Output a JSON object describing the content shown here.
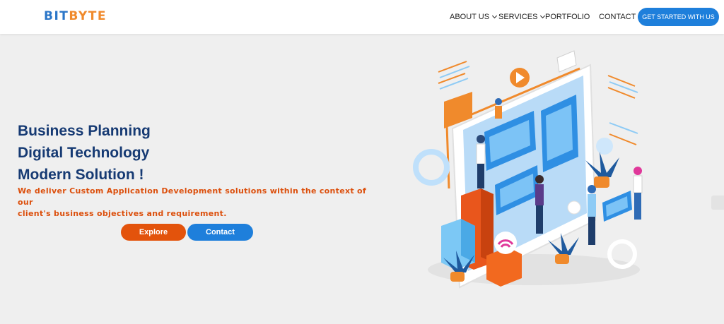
{
  "brand": {
    "logo_part1": "BIT",
    "logo_part2": "BYTE"
  },
  "nav": {
    "items": [
      {
        "label": "ABOUT US",
        "has_dropdown": true
      },
      {
        "label": "SERVICES",
        "has_dropdown": true
      },
      {
        "label": "PORTFOLIO",
        "has_dropdown": false
      },
      {
        "label": "CONTACT",
        "has_dropdown": false
      }
    ],
    "cta_label": "GET STARTED WITH US"
  },
  "hero": {
    "title_lines": [
      "Business Planning",
      "Digital Technology",
      "Modern Solution !"
    ],
    "subtitle_line1": "We deliver Custom Application Development solutions within the context of our",
    "subtitle_line2": "client's business objectives and requirement.",
    "explore_label": "Explore",
    "contact_label": "Contact"
  },
  "icons": {
    "illustration": "isometric-team-dashboard-illustration",
    "side_widget": "envelope-icon"
  },
  "colors": {
    "brand_blue": "#1e7fdb",
    "brand_orange": "#e3530c",
    "title_navy": "#163a73",
    "background": "#efefef"
  }
}
